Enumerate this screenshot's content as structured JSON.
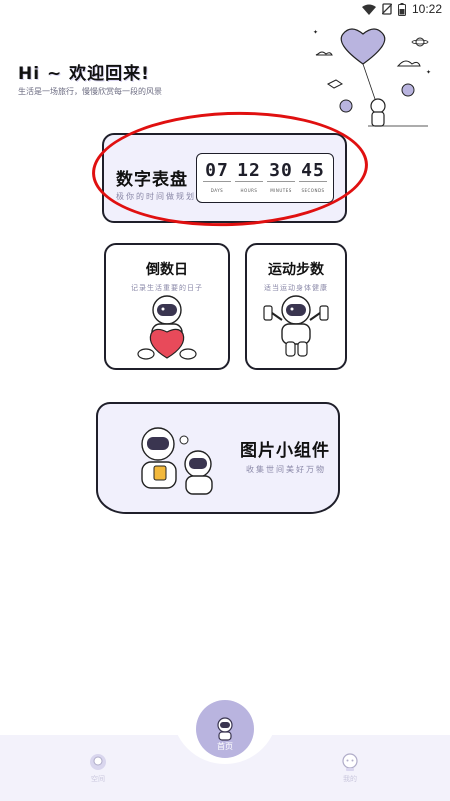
{
  "status_bar": {
    "time": "10:22",
    "icons": [
      "wifi-icon",
      "no-sim-icon",
      "battery-icon"
    ]
  },
  "header": {
    "greeting": "Hi ~ 欢迎回来!",
    "subtitle": "生活是一场旅行，慢慢欣赏每一段的风景"
  },
  "cards": {
    "digital_clock": {
      "title": "数字表盘",
      "subtitle": "极你的时间做规划",
      "clock": [
        {
          "value": "07",
          "label": "DAYS"
        },
        {
          "value": "12",
          "label": "HOURS"
        },
        {
          "value": "30",
          "label": "MINUTES"
        },
        {
          "value": "45",
          "label": "SECONDS"
        }
      ]
    },
    "countdown": {
      "title": "倒数日",
      "subtitle": "记录生活重要的日子"
    },
    "steps": {
      "title": "运动步数",
      "subtitle": "适当运动身体健康"
    },
    "photo_widget": {
      "title": "图片小组件",
      "subtitle": "收集世间美好万物"
    }
  },
  "nav": {
    "left_label": "空间",
    "center_label": "首页",
    "right_label": "我的"
  },
  "colors": {
    "accent": "#b9b4df",
    "card_bg": "#f1f0fc",
    "highlight": "#e01010"
  }
}
